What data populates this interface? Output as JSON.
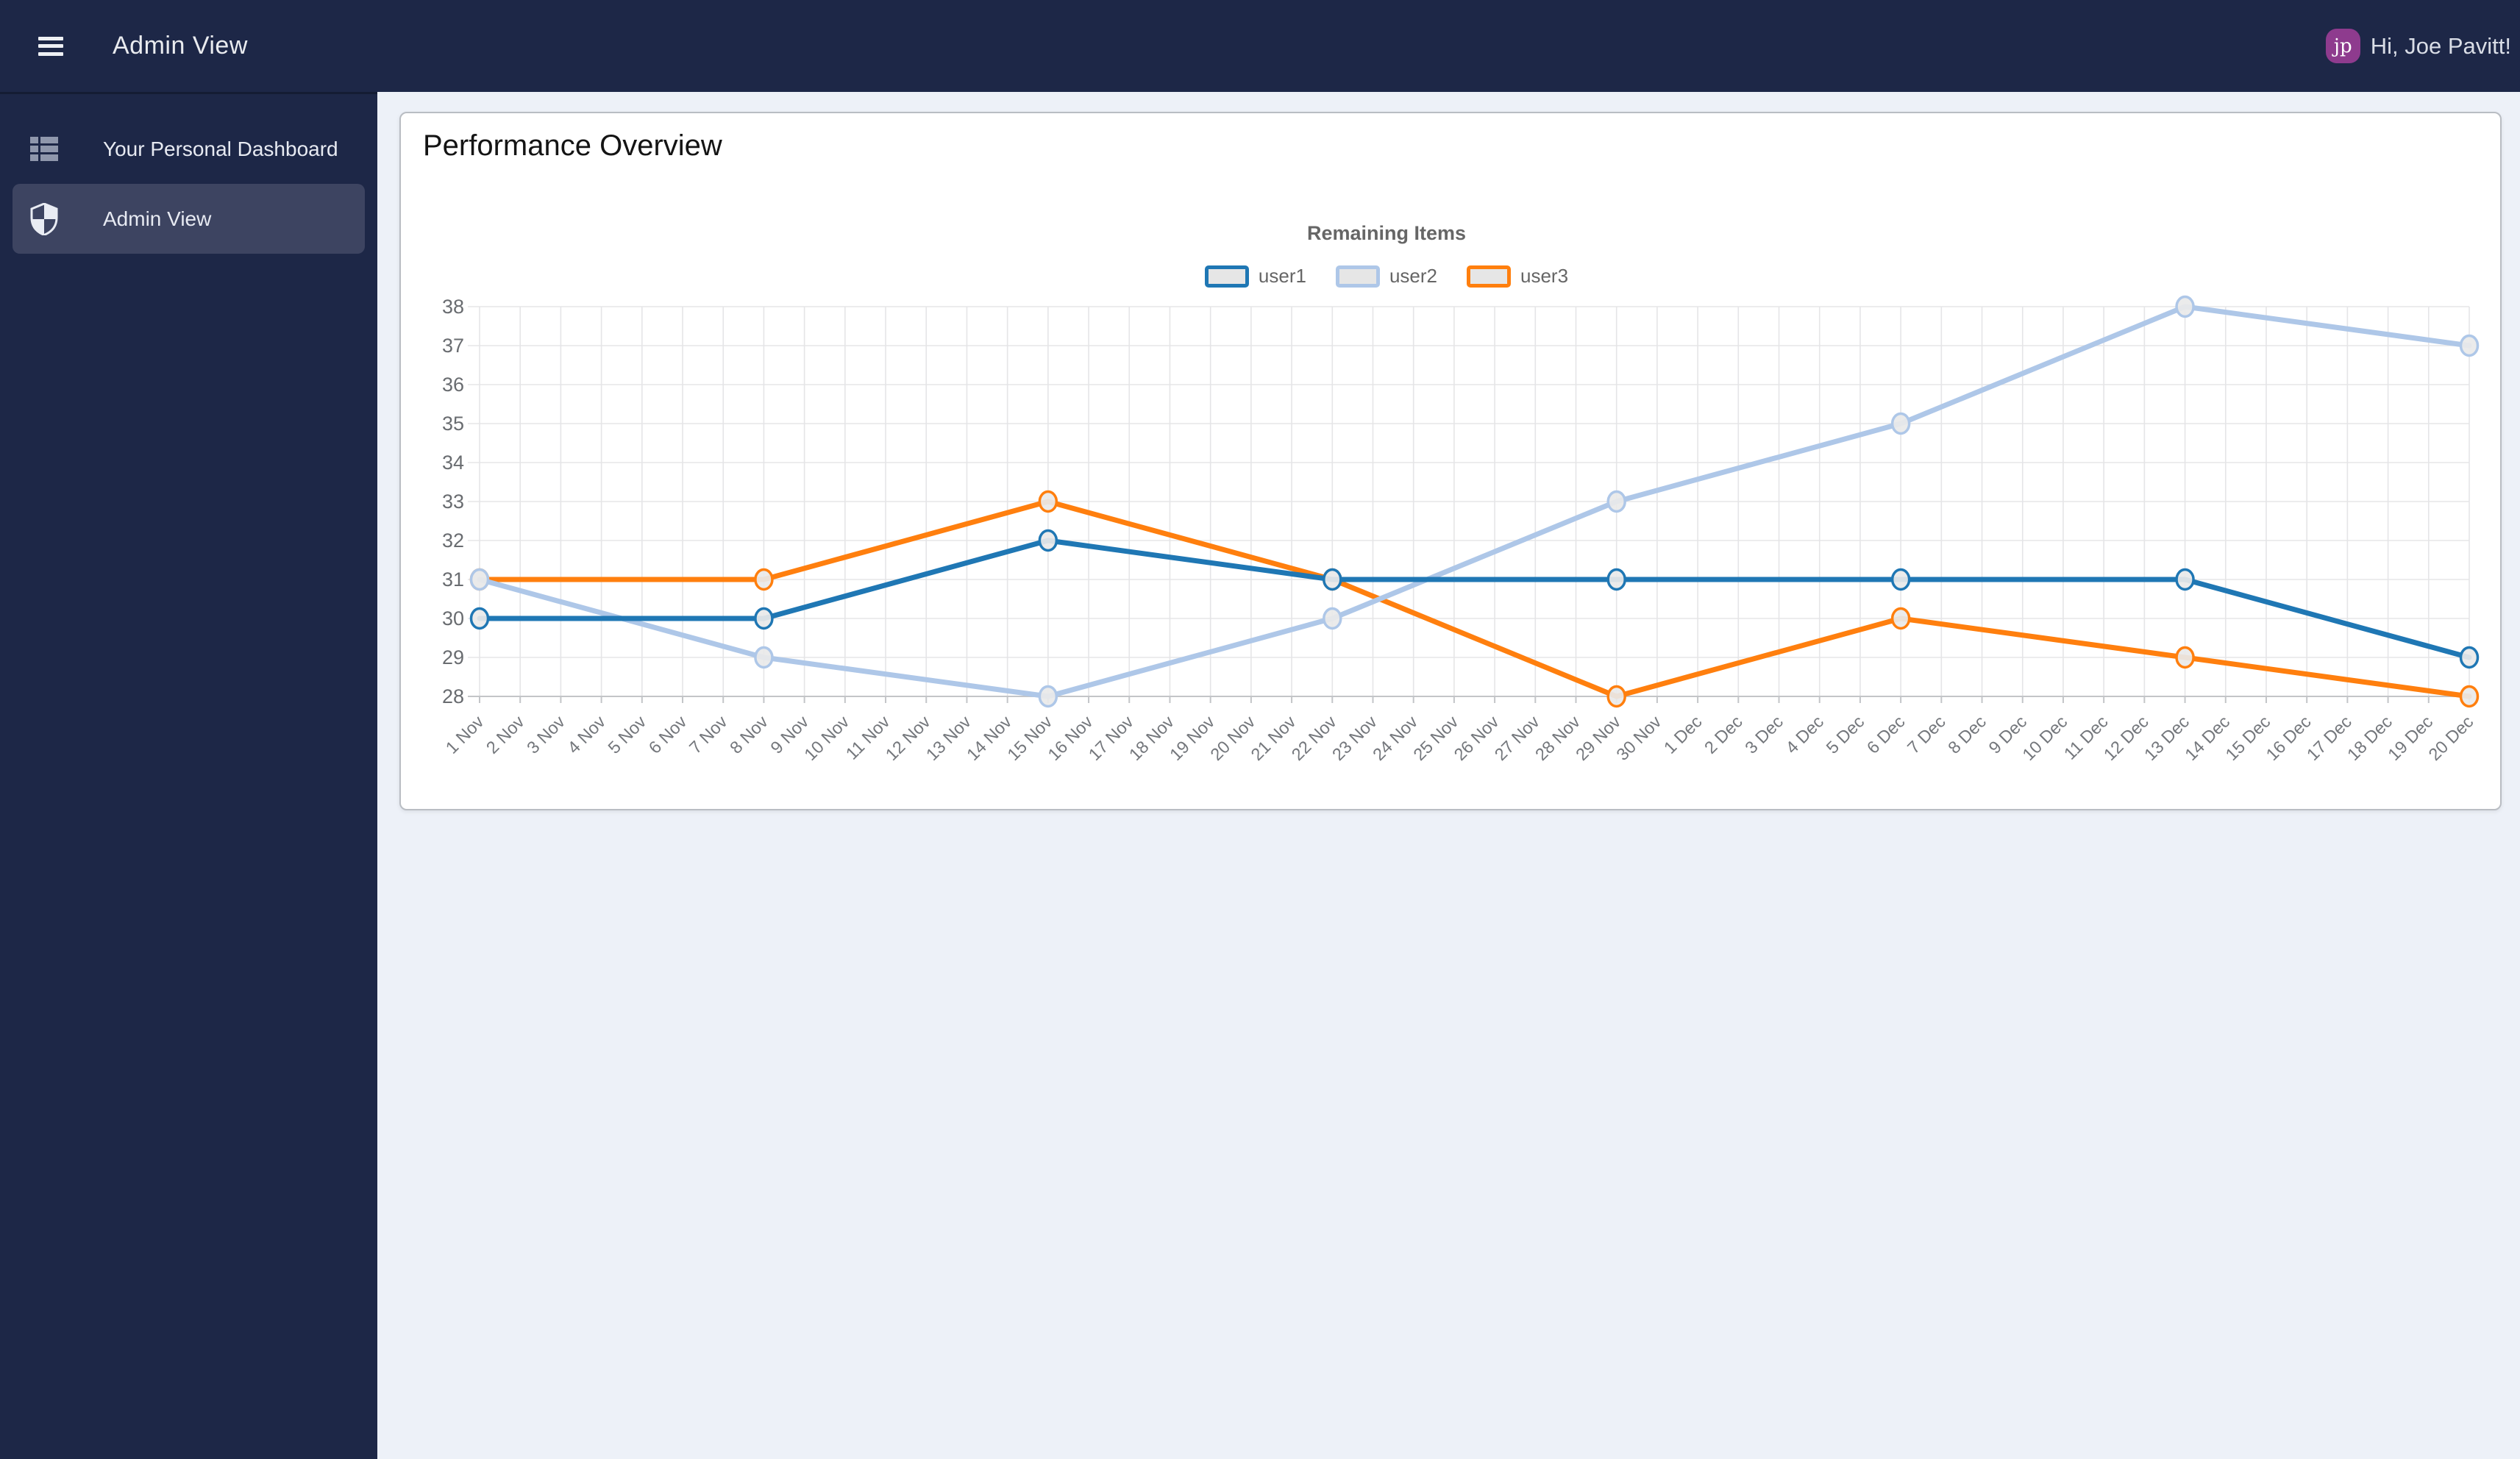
{
  "navbar": {
    "title": "Admin View",
    "avatar_initials": "jp",
    "avatar_color": "#8e3b8e",
    "greeting": "Hi, Joe Pavitt!"
  },
  "sidebar": {
    "items": [
      {
        "label": "Your Personal Dashboard",
        "icon": "dashboard-list-icon",
        "active": false
      },
      {
        "label": "Admin View",
        "icon": "shield-icon",
        "active": true
      }
    ]
  },
  "main": {
    "card_title": "Performance Overview"
  },
  "chart_data": {
    "type": "line",
    "title": "Remaining Items",
    "legend_position": "top",
    "grid": true,
    "ylim": [
      28,
      38
    ],
    "ytick_step": 1,
    "categories": [
      "1 Nov",
      "2 Nov",
      "3 Nov",
      "4 Nov",
      "5 Nov",
      "6 Nov",
      "7 Nov",
      "8 Nov",
      "9 Nov",
      "10 Nov",
      "11 Nov",
      "12 Nov",
      "13 Nov",
      "14 Nov",
      "15 Nov",
      "16 Nov",
      "17 Nov",
      "18 Nov",
      "19 Nov",
      "20 Nov",
      "21 Nov",
      "22 Nov",
      "23 Nov",
      "24 Nov",
      "25 Nov",
      "26 Nov",
      "27 Nov",
      "28 Nov",
      "29 Nov",
      "30 Nov",
      "1 Dec",
      "2 Dec",
      "3 Dec",
      "4 Dec",
      "5 Dec",
      "6 Dec",
      "7 Dec",
      "8 Dec",
      "9 Dec",
      "10 Dec",
      "11 Dec",
      "12 Dec",
      "13 Dec",
      "14 Dec",
      "15 Dec",
      "16 Dec",
      "17 Dec",
      "18 Dec",
      "19 Dec",
      "20 Dec"
    ],
    "point_dates": [
      "1 Nov",
      "8 Nov",
      "15 Nov",
      "22 Nov",
      "29 Nov",
      "6 Dec",
      "13 Dec",
      "20 Dec"
    ],
    "series": [
      {
        "name": "user1",
        "color": "#1f77b4",
        "values": [
          30,
          30,
          32,
          31,
          31,
          31,
          31,
          29
        ]
      },
      {
        "name": "user2",
        "color": "#aec7e8",
        "values": [
          31,
          29,
          28,
          30,
          33,
          35,
          38,
          37
        ]
      },
      {
        "name": "user3",
        "color": "#ff7f0e",
        "values": [
          31,
          31,
          33,
          31,
          28,
          30,
          29,
          28
        ]
      }
    ],
    "marker_fill": "#e9e9e9",
    "grid_color": "#e5e5e7",
    "axis_color": "#c3c5c8",
    "tick_text_color": "#74777c"
  }
}
